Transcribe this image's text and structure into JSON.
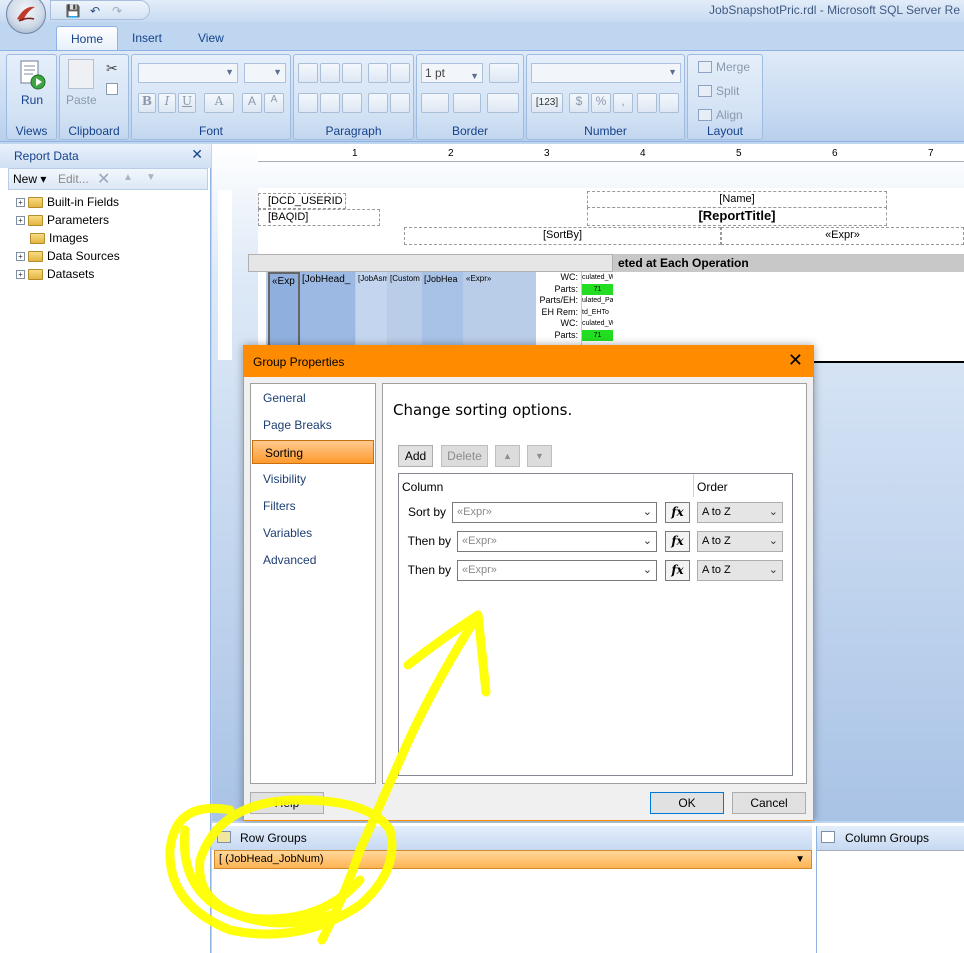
{
  "window": {
    "title": "JobSnapshotPric.rdl - Microsoft SQL Server Re"
  },
  "ribbon": {
    "tabs": [
      "Home",
      "Insert",
      "View"
    ],
    "active_tab": "Home",
    "groups": {
      "views": {
        "label": "Views",
        "run_label": "Run"
      },
      "clipboard": {
        "label": "Clipboard",
        "paste_label": "Paste"
      },
      "font": {
        "label": "Font"
      },
      "paragraph": {
        "label": "Paragraph"
      },
      "border": {
        "label": "Border",
        "width_value": "1 pt"
      },
      "number": {
        "label": "Number",
        "format_glyphs": [
          "[123]",
          "$",
          "%",
          ","
        ]
      },
      "layout": {
        "label": "Layout",
        "merge_label": "Merge",
        "split_label": "Split",
        "align_label": "Align"
      }
    }
  },
  "report_data": {
    "title": "Report Data",
    "toolbar": {
      "new_label": "New",
      "edit_label": "Edit..."
    },
    "tree": [
      {
        "label": "Built-in Fields",
        "expandable": true
      },
      {
        "label": "Parameters",
        "expandable": true
      },
      {
        "label": "Images",
        "expandable": false
      },
      {
        "label": "Data Sources",
        "expandable": true
      },
      {
        "label": "Datasets",
        "expandable": true
      }
    ]
  },
  "ruler": {
    "marks": [
      "1",
      "2",
      "3",
      "4",
      "5",
      "6",
      "7"
    ]
  },
  "report": {
    "userid": "[DCD_USERID",
    "baqid": "[BAQID]",
    "name": "[Name]",
    "report_title": "[ReportTitle]",
    "sortby": "[SortBy]",
    "expr": "«Expr»",
    "tablix_header": "eted at Each Operation",
    "cells": [
      "«Exp",
      "[JobHead_",
      "[JobAsm",
      "[Custom",
      "[JobHea",
      "«Expr»"
    ],
    "labels_block": [
      "WC:",
      "Parts:",
      "Parts/EH:",
      "EH Rem:",
      "WC:",
      "Parts:"
    ],
    "calc_cells": [
      "culated_W",
      "71",
      "ulated_Pa",
      "td_EHTo",
      "culated_W",
      "71"
    ]
  },
  "dialog": {
    "title": "Group Properties",
    "nav": [
      "General",
      "Page Breaks",
      "Sorting",
      "Visibility",
      "Filters",
      "Variables",
      "Advanced"
    ],
    "active_nav": "Sorting",
    "heading": "Change sorting options.",
    "buttons": {
      "add": "Add",
      "delete": "Delete",
      "help": "Help",
      "ok": "OK",
      "cancel": "Cancel"
    },
    "columns": {
      "column": "Column",
      "order": "Order"
    },
    "rows": [
      {
        "label": "Sort by",
        "expression": "«Expr»",
        "order": "A to Z"
      },
      {
        "label": "Then by",
        "expression": "«Expr»",
        "order": "A to Z"
      },
      {
        "label": "Then by",
        "expression": "«Expr»",
        "order": "A to Z"
      }
    ],
    "fx_label": "fx"
  },
  "groups_pane": {
    "row_groups_label": "Row Groups",
    "column_groups_label": "Column Groups",
    "row_group_item": "[ (JobHead_JobNum)"
  },
  "colors": {
    "dialog_accent": "#ff8c00",
    "annotation": "#ffff00",
    "ribbon": "#c5d9f1"
  }
}
